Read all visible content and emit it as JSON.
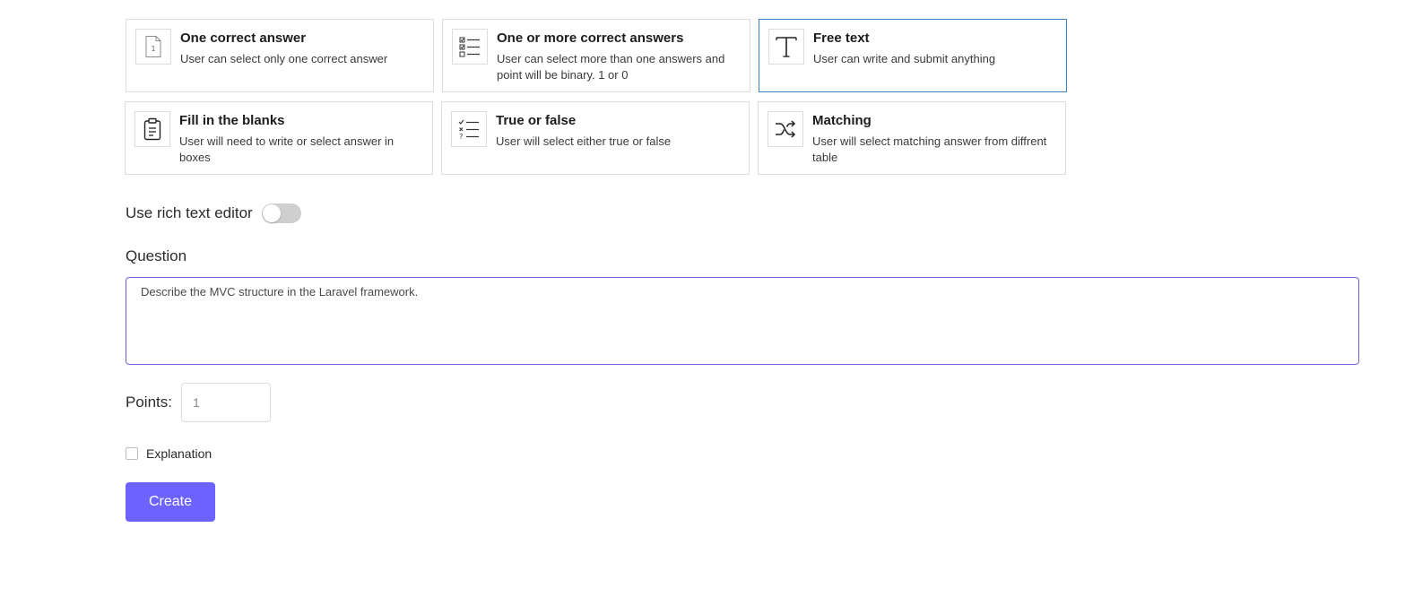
{
  "question_types": [
    {
      "title": "One correct answer",
      "description": "User can select only one correct answer",
      "icon": "document-number-icon",
      "selected": false
    },
    {
      "title": "One or more correct answers",
      "description": "User can select more than one answers and point will be binary. 1 or 0",
      "icon": "checklist-icon",
      "selected": false
    },
    {
      "title": "Free text",
      "description": "User can write and submit anything",
      "icon": "text-t-icon",
      "selected": true
    },
    {
      "title": "Fill in the blanks",
      "description": "User will need to write or select answer in boxes",
      "icon": "clipboard-icon",
      "selected": false
    },
    {
      "title": "True or false",
      "description": "User will select either true or false",
      "icon": "true-false-list-icon",
      "selected": false
    },
    {
      "title": "Matching",
      "description": "User will select matching answer from diffrent table",
      "icon": "shuffle-icon",
      "selected": false
    }
  ],
  "rich_text": {
    "label": "Use rich text editor",
    "enabled": false
  },
  "question": {
    "label": "Question",
    "value": "Describe the MVC structure in the Laravel framework."
  },
  "points": {
    "label": "Points:",
    "value": "1"
  },
  "explanation": {
    "label": "Explanation",
    "checked": false
  },
  "create_button": {
    "label": "Create"
  },
  "colors": {
    "accent": "#6c63ff",
    "selected_border": "#3b82c4",
    "focus_border": "#6b63d9"
  }
}
